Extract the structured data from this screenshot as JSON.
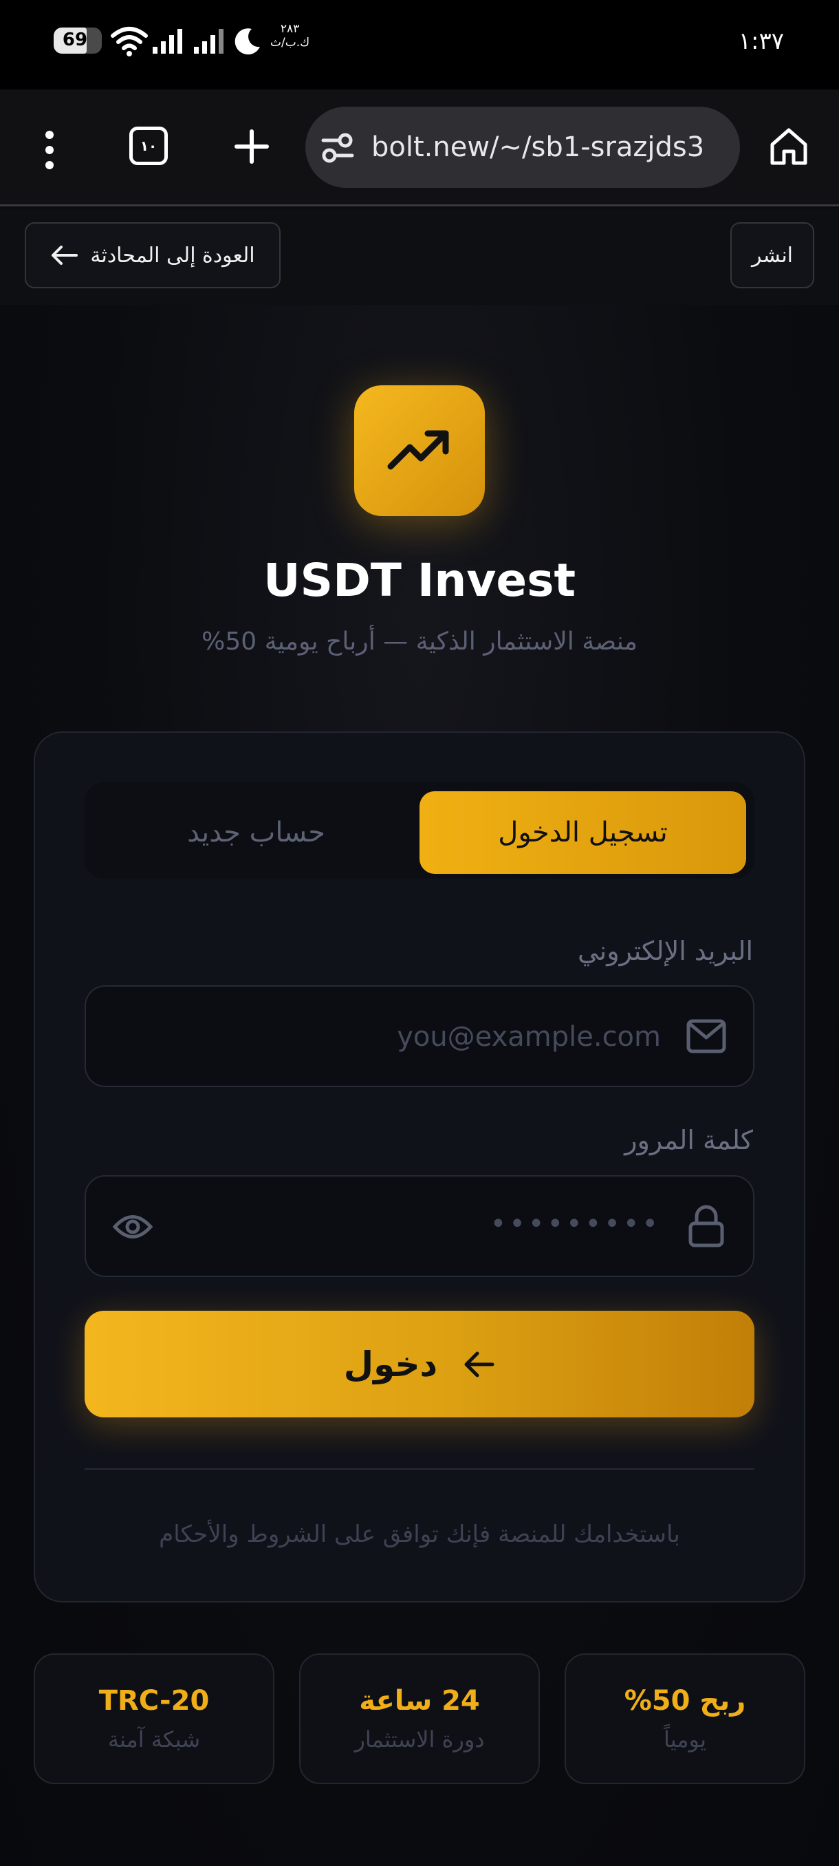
{
  "status_bar": {
    "battery_level": "69",
    "battery_fraction": 0.69,
    "time": "١:٣٧",
    "small_text_top": "٢٨٣",
    "small_text_bottom": "ك.ب/ث",
    "icons": [
      "battery-icon",
      "wifi-icon",
      "signal-icon",
      "signal-icon",
      "moon-icon"
    ]
  },
  "browser": {
    "url": "bolt.new/~/sb1-srazjds3",
    "tab_count": "١٠",
    "icons": [
      "more-vert-icon",
      "tabs-icon",
      "plus-icon",
      "site-settings-icon",
      "home-icon"
    ]
  },
  "bolt_toolbar": {
    "back_label": "العودة إلى المحادثة",
    "publish_label": "انشر"
  },
  "app": {
    "title": "USDT Invest",
    "subtitle": "منصة الاستثمار الذكية — أرباح يومية 50%",
    "accent_color": "#f0ae18",
    "tabs": [
      {
        "label": "تسجيل الدخول",
        "active": true
      },
      {
        "label": "حساب جديد",
        "active": false
      }
    ],
    "email": {
      "label": "البريد الإلكتروني",
      "placeholder": "you@example.com"
    },
    "password": {
      "label": "كلمة المرور",
      "placeholder": "•••••••••"
    },
    "submit_label": "دخول",
    "terms": "باستخدامك للمنصة فإنك توافق على الشروط والأحكام",
    "stats": [
      {
        "value": "ربح 50%",
        "caption": "يومياً"
      },
      {
        "value": "24 ساعة",
        "caption": "دورة الاستثمار"
      },
      {
        "value": "TRC-20",
        "caption": "شبكة آمنة"
      }
    ]
  }
}
